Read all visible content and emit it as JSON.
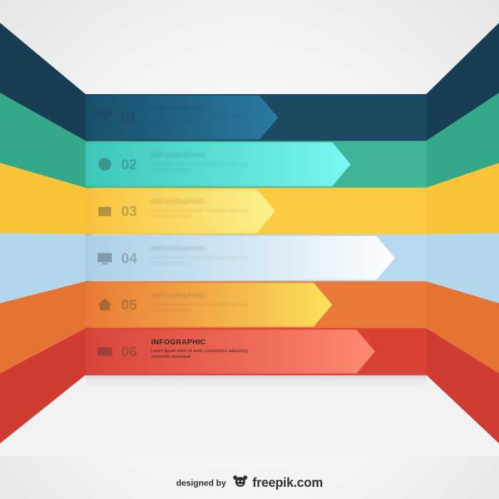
{
  "rows": [
    {
      "color": "#1c4a63",
      "arrow_from": "#18506b",
      "arrow_to": "#2a7aa3",
      "wall": "#173e54",
      "number": "01",
      "icon": "wifi-icon",
      "title": "INFOGRAPHIC",
      "desc": "Lorem ipsum dolor sit amet, consectetur adipiscing, commodo consequat"
    },
    {
      "color": "#3fb596",
      "arrow_from": "#3dc9bb",
      "arrow_to": "#7cf7f4",
      "wall": "#35a88a",
      "number": "02",
      "icon": "globe-icon",
      "title": "INFOGRAPHIC",
      "desc": "Lorem ipsum dolor sit amet, consectetur adipiscing, commodo consequat"
    },
    {
      "color": "#fccb43",
      "arrow_from": "#f8c23c",
      "arrow_to": "#fdf38f",
      "wall": "#f9c33a",
      "number": "03",
      "icon": "folder-icon",
      "title": "INFOGRAPHIC",
      "desc": "Lorem ipsum dolor sit amet, consectetur adipiscing, commodo consequat"
    },
    {
      "color": "#b7d9ee",
      "arrow_from": "#a9cfe6",
      "arrow_to": "#ffffff",
      "wall": "#b2d6ec",
      "number": "04",
      "icon": "screen-icon",
      "title": "INFOGRAPHIC",
      "desc": "Lorem ipsum dolor sit amet, consectetur adipiscing, commodo consequat"
    },
    {
      "color": "#e8793a",
      "arrow_from": "#ea7a36",
      "arrow_to": "#fbe35a",
      "wall": "#e57334",
      "number": "05",
      "icon": "home-icon",
      "title": "INFOGRAPHIC",
      "desc": "Lorem ipsum dolor sit amet, consectetur adipiscing, commodo consequat"
    },
    {
      "color": "#d84236",
      "arrow_from": "#d8453a",
      "arrow_to": "#ff8a72",
      "wall": "#d03c32",
      "number": "06",
      "icon": "cart-icon",
      "title": "INFOGRAPHIC",
      "desc": "Lorem ipsum dolor sit amet, consectetur adipiscing, commodo consequat"
    }
  ],
  "credit": {
    "designed_by": "designed by",
    "brand": "freepik.com"
  }
}
